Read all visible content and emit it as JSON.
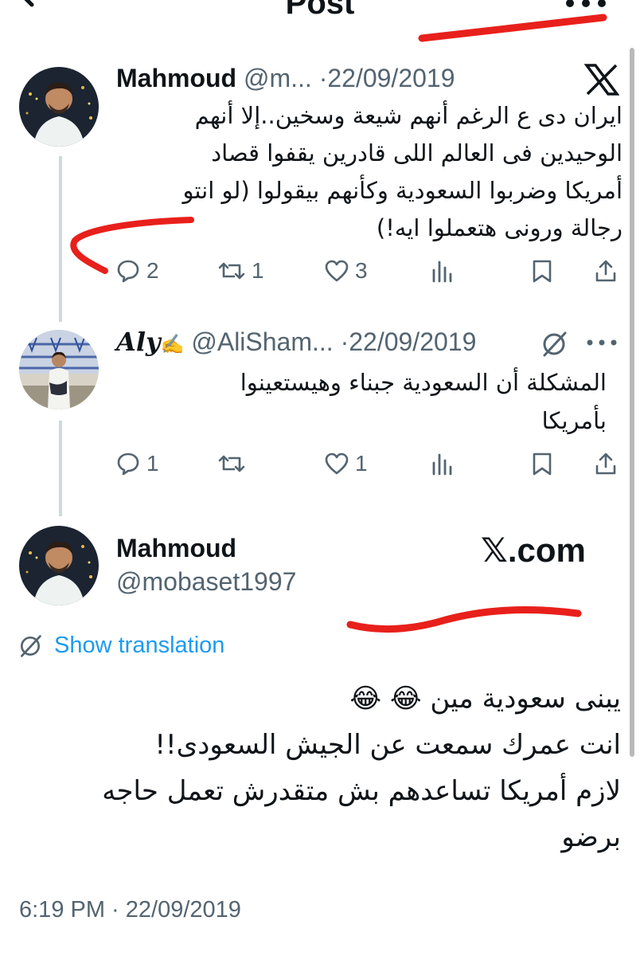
{
  "header": {
    "title": "Post",
    "back_icon": "arrow-left-icon",
    "more_icon": "more-horizontal-icon"
  },
  "tweets": [
    {
      "name": "Mahmoud",
      "handle": "@m...",
      "dot": "·",
      "date": "22/09/2019",
      "badge_icon": "x-logo-icon",
      "text_lines": [
        "ايران دى ع الرغم أنهم شيعة وسخين..إلا أنهم",
        "الوحيدين فى العالم اللى قادرين يقفوا قصاد",
        "أمريكا وضربوا السعودية وكأنهم بيقولوا (لو انتو",
        "رجالة ورونى هتعملوا ايه!)"
      ],
      "actions": {
        "replies": "2",
        "reposts": "1",
        "likes": "3"
      }
    },
    {
      "name": "Aly",
      "handle": "@AliSham...",
      "dot": "·",
      "date": "22/09/2019",
      "badge_icon": "no-translate-icon",
      "more_icon": "more-horizontal-icon",
      "text_lines": [
        "المشكلة أن السعودية جبناء وهيستعينوا",
        "بأمريكا"
      ],
      "actions": {
        "replies": "1",
        "reposts": "",
        "likes": "1"
      }
    }
  ],
  "main_post": {
    "name": "Mahmoud",
    "handle": "@mobaset1997",
    "watermark": "𝕏.com",
    "translate_label": "Show translation",
    "text_lines": [
      "يبنى سعودية مين 😂 😂",
      "انت عمرك سمعت عن الجيش السعودى!!",
      "لازم أمريكا تساعدهم بش متقدرش تعمل حاجه",
      "برضو"
    ],
    "timestamp": "6:19 PM · 22/09/2019"
  },
  "colors": {
    "accent": "#1d9bf0",
    "muted": "#536471",
    "annotation_red": "#e8201b",
    "thread_line": "#cfd9de"
  }
}
